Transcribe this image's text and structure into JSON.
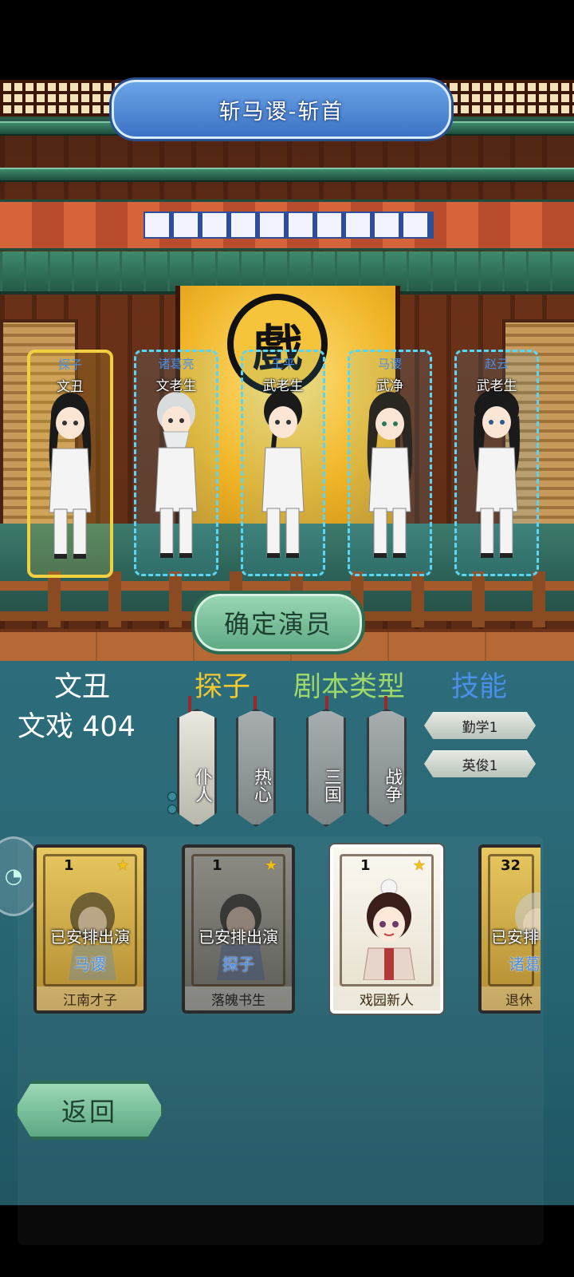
{
  "stage": {
    "title": "斩马谡-斩首",
    "emblem": "戲",
    "confirm_label": "确定演员"
  },
  "actors": [
    {
      "role": "探子",
      "type": "文丑",
      "selected": true
    },
    {
      "role": "诸葛亮",
      "type": "文老生",
      "selected": false
    },
    {
      "role": "王平",
      "type": "武老生",
      "selected": false
    },
    {
      "role": "马谡",
      "type": "武净",
      "selected": false
    },
    {
      "role": "赵云",
      "type": "武老生",
      "selected": false
    }
  ],
  "info": {
    "type": "文丑",
    "score_line": "文戏 404",
    "headers": {
      "role": "探子",
      "script_type": "剧本类型",
      "skill": "技能"
    },
    "role_tags": [
      "仆人",
      "热心"
    ],
    "script_tags": [
      "三国",
      "战争"
    ],
    "skills": [
      "勤学1",
      "英俊1"
    ]
  },
  "cards": [
    {
      "level": "1",
      "status": "已安排出演",
      "assigned_role": "马谡",
      "name": "江南才子",
      "style": "gold"
    },
    {
      "level": "1",
      "status": "已安排出演",
      "assigned_role": "探子",
      "name": "落魄书生",
      "style": "gray"
    },
    {
      "level": "1",
      "status": "",
      "assigned_role": "",
      "name": "戏园新人",
      "style": "white"
    },
    {
      "level": "32",
      "status": "已安排",
      "assigned_role": "诸葛",
      "name": "退休",
      "style": "gold"
    }
  ],
  "nav": {
    "back_label": "返回"
  },
  "colors": {
    "selected_border": "#f0d040",
    "slot_border": "#5ad6f4",
    "role_text": "#4a8fe8",
    "header_role": "#f0c830",
    "header_script": "#9cd86a",
    "header_skill": "#4a8fe8",
    "panel_bg": "#2a6876"
  }
}
